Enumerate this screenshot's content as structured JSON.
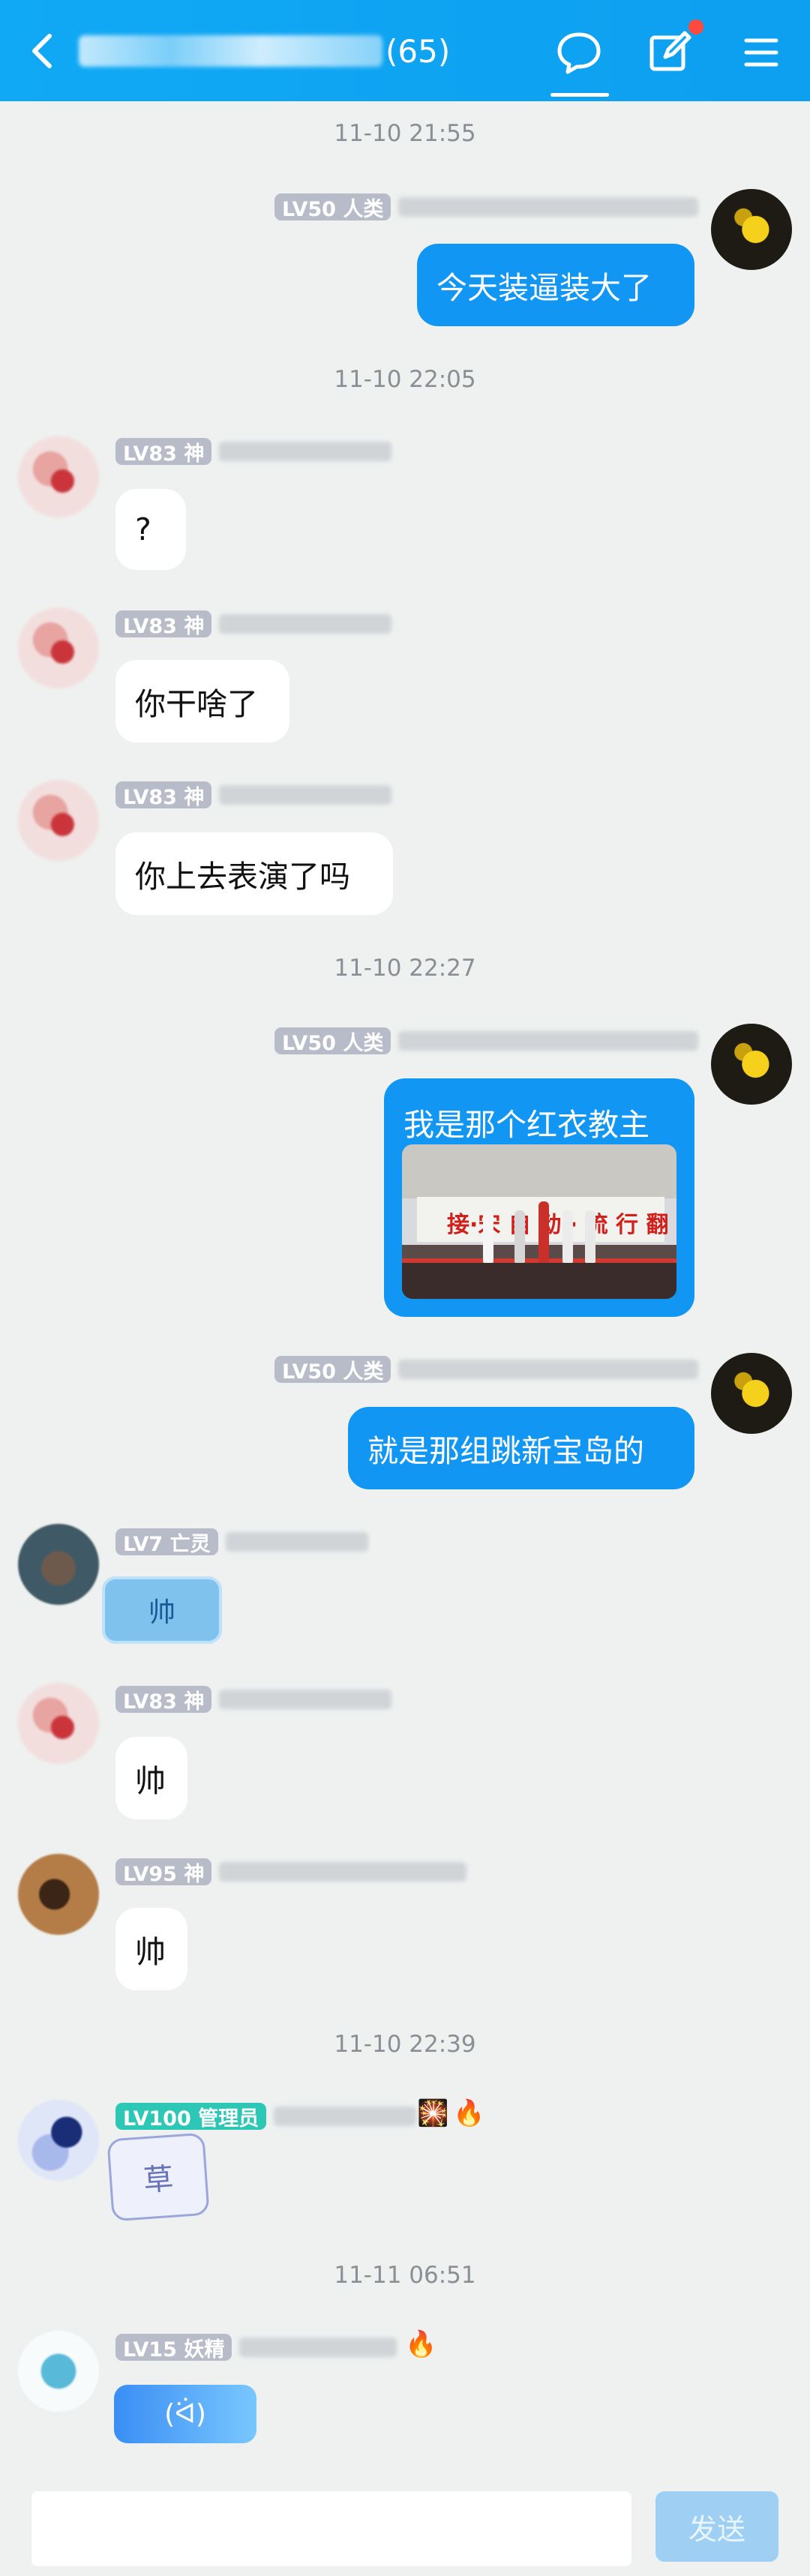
{
  "header": {
    "title_count": "(65)",
    "icons": [
      "back-icon",
      "chat-bubble-icon",
      "edit-icon",
      "menu-icon"
    ],
    "accent_color": "#10a9f5"
  },
  "messages": [
    {
      "type": "timestamp",
      "text": "11-10 21:55"
    },
    {
      "type": "message",
      "side": "out",
      "level": "LV50 人类",
      "text": "今天装逼装大了"
    },
    {
      "type": "timestamp",
      "text": "11-10 22:05"
    },
    {
      "type": "message",
      "side": "in",
      "level": "LV83 神",
      "text": "?"
    },
    {
      "type": "message",
      "side": "in",
      "level": "LV83 神",
      "text": "你干啥了"
    },
    {
      "type": "message",
      "side": "in",
      "level": "LV83 神",
      "text": "你上去表演了吗"
    },
    {
      "type": "timestamp",
      "text": "11-10 22:27"
    },
    {
      "type": "message",
      "side": "out",
      "level": "LV50 人类",
      "text": "我是那个红衣教主",
      "has_photo": true
    },
    {
      "type": "message",
      "side": "out",
      "level": "LV50 人类",
      "text": "就是那组跳新宝岛的"
    },
    {
      "type": "message",
      "side": "in",
      "level": "LV7 亡灵",
      "sticker": "帅"
    },
    {
      "type": "message",
      "side": "in",
      "level": "LV83 神",
      "text": "帅"
    },
    {
      "type": "message",
      "side": "in",
      "level": "LV95 神",
      "text": "帅"
    },
    {
      "type": "timestamp",
      "text": "11-10 22:39"
    },
    {
      "type": "message",
      "side": "in",
      "level": "LV100 管理员",
      "sticker": "草"
    },
    {
      "type": "timestamp",
      "text": "11-11 06:51"
    },
    {
      "type": "message",
      "side": "in",
      "level": "LV15 妖精",
      "sticker": "(ᐛ)"
    }
  ],
  "photo": {
    "banner_text": "接·宋 自 动 · 流 行 翻"
  },
  "input": {
    "placeholder": "",
    "send_label": "发送"
  }
}
